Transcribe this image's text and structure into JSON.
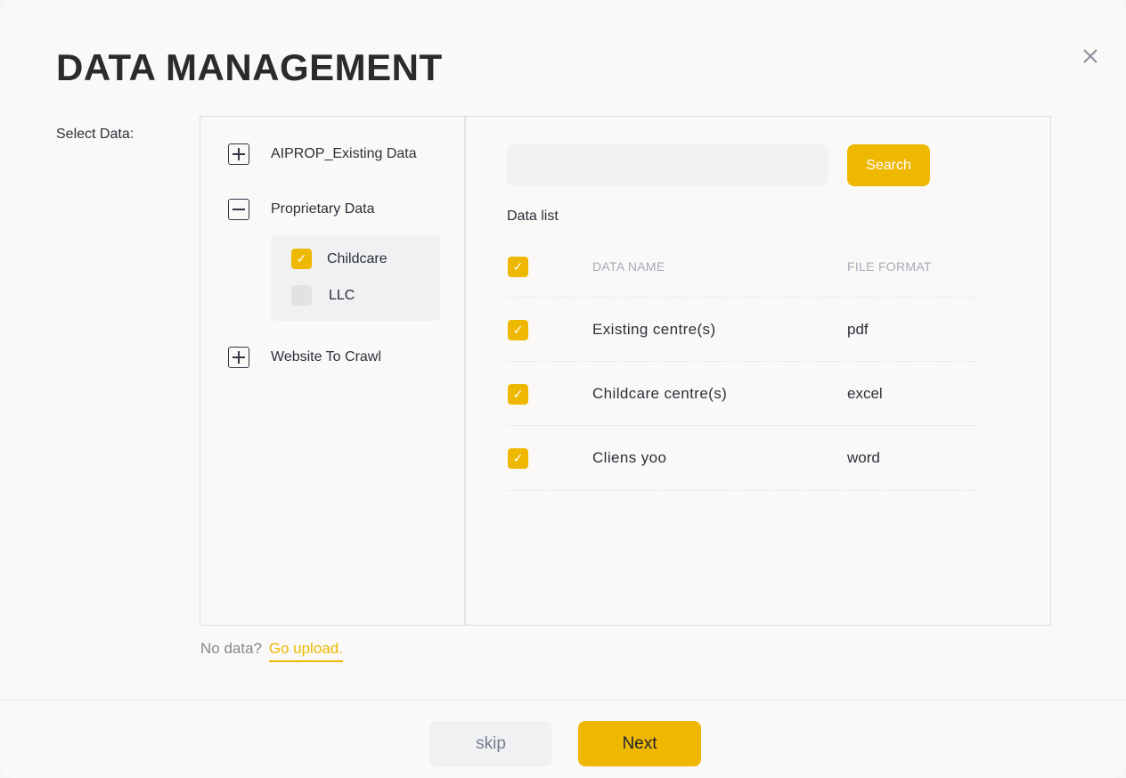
{
  "title": "DATA MANAGEMENT",
  "select_label": "Select Data:",
  "tree": [
    {
      "label": "AIPROP_Existing Data",
      "expanded": false
    },
    {
      "label": "Proprietary Data",
      "expanded": true,
      "children": [
        {
          "label": "Childcare",
          "checked": true
        },
        {
          "label": "LLC",
          "checked": false
        }
      ]
    },
    {
      "label": "Website To Crawl",
      "expanded": false
    }
  ],
  "search": {
    "placeholder": "",
    "button": "Search"
  },
  "data_list_label": "Data list",
  "table": {
    "headers": [
      "DATA NAME",
      "FILE FORMAT"
    ],
    "all_checked": true,
    "rows": [
      {
        "name": "Existing centre(s)",
        "format": "pdf",
        "checked": true
      },
      {
        "name": "Childcare centre(s)",
        "format": "excel",
        "checked": true
      },
      {
        "name": "Cliens yoo",
        "format": "word",
        "checked": true
      }
    ]
  },
  "no_data": "No data?",
  "upload_link": "Go upload.",
  "buttons": {
    "skip": "skip",
    "next": "Next"
  },
  "colors": {
    "accent": "#efb800"
  }
}
